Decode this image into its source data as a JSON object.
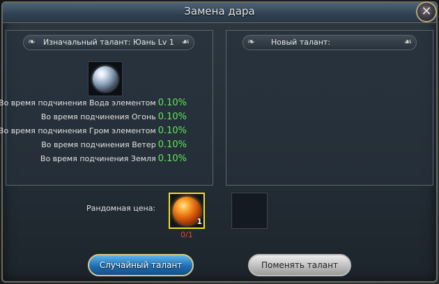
{
  "window": {
    "title": "Замена дара",
    "close_label": "✕"
  },
  "left_panel": {
    "header": "Изначальный талант: Юань Lv 1",
    "stats": [
      {
        "label": "Во время подчинения Вода элементом",
        "value": "0.10%"
      },
      {
        "label": "Во время подчинения Огонь",
        "value": "0.10%"
      },
      {
        "label": "Во время подчинения Гром элементом",
        "value": "0.10%"
      },
      {
        "label": "Во время подчинения Ветер",
        "value": "0.10%"
      },
      {
        "label": "Во время подчинения Земля",
        "value": "0.10%"
      }
    ]
  },
  "right_panel": {
    "header": "Новый талант:"
  },
  "cost": {
    "label": "Рандомная цена:",
    "item_quantity": "1",
    "have_need": "0/1"
  },
  "buttons": {
    "random": "Случайный талант",
    "swap": "Поменять талант"
  },
  "colors": {
    "value_green": "#5ee85a",
    "highlight_yellow": "#f3e11c",
    "count_red": "#e04a32"
  }
}
